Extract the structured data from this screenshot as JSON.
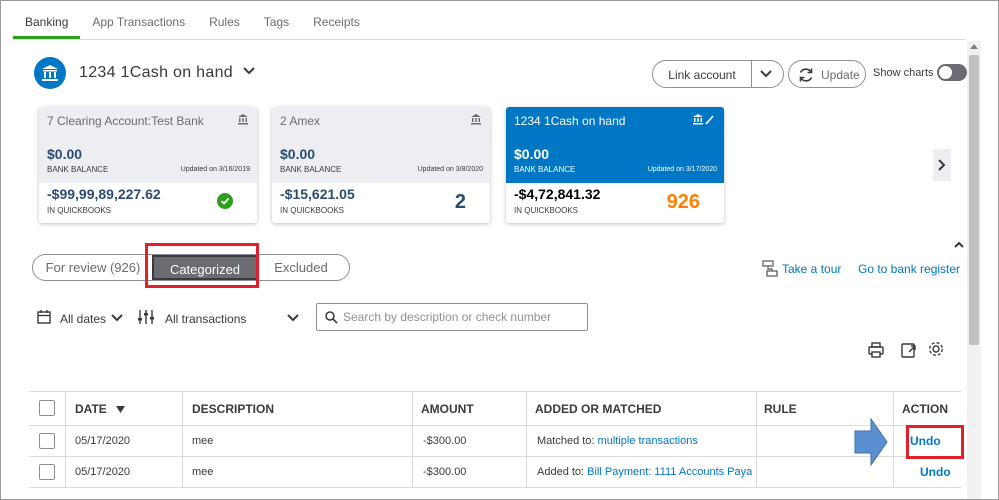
{
  "top_tabs": [
    "Banking",
    "App Transactions",
    "Rules",
    "Tags",
    "Receipts"
  ],
  "account": {
    "name": "1234 1Cash on hand",
    "link_account": "Link account",
    "update": "Update",
    "show_charts": "Show charts"
  },
  "cards": [
    {
      "name": "7 Clearing Account:Test Bank",
      "bank_balance": "$0.00",
      "bank_balance_label": "BANK BALANCE",
      "updated": "Updated on 3/16/2019",
      "qb_balance": "-$99,99,89,227.62",
      "qb_label": "IN QUICKBOOKS",
      "count": ""
    },
    {
      "name": "2 Amex",
      "bank_balance": "$0.00",
      "bank_balance_label": "BANK BALANCE",
      "updated": "Updated on 3/8/2020",
      "qb_balance": "-$15,621.05",
      "qb_label": "IN QUICKBOOKS",
      "count": "2"
    },
    {
      "name": "1234 1Cash on hand",
      "bank_balance": "$0.00",
      "bank_balance_label": "BANK BALANCE",
      "updated": "Updated on 3/17/2020",
      "qb_balance": "-$4,72,841.32",
      "qb_label": "IN QUICKBOOKS",
      "count": "926"
    }
  ],
  "filter_tabs": [
    "For review (926)",
    "Categorized",
    "Excluded"
  ],
  "links": {
    "take_tour": "Take a tour",
    "bank_register": "Go to bank register"
  },
  "filters": {
    "dates": "All dates",
    "transactions": "All transactions",
    "search_placeholder": "Search by description or check number"
  },
  "table": {
    "columns": [
      "DATE",
      "DESCRIPTION",
      "AMOUNT",
      "ADDED OR MATCHED",
      "RULE",
      "ACTION"
    ],
    "rows": [
      {
        "date": "05/17/2020",
        "description": "mee",
        "amount": "-$300.00",
        "match_prefix": "Matched to:",
        "match_link": "multiple transactions",
        "rule": "",
        "action": "Undo"
      },
      {
        "date": "05/17/2020",
        "description": "mee",
        "amount": "-$300.00",
        "match_prefix": "Added to:",
        "match_link": "Bill Payment: 1111 Accounts Paya",
        "rule": "",
        "action": "Undo"
      }
    ]
  },
  "colors": {
    "accent_blue": "#0077c5",
    "green": "#2ca01c",
    "count_orange": "#ff8000",
    "highlight_red": "#e0202a"
  }
}
